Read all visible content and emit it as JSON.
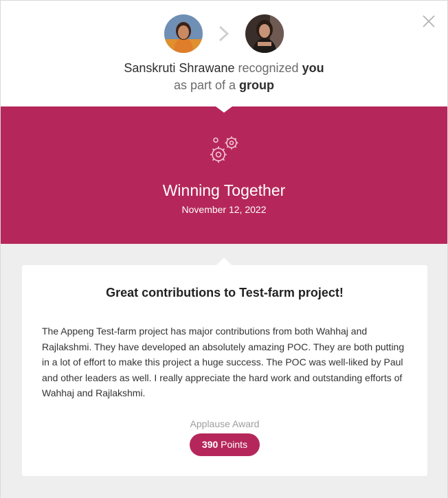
{
  "header": {
    "sender_name": "Sanskruti Shrawane",
    "verb": "recognized",
    "recipient": "you",
    "line2_prefix": "as part of a",
    "line2_group": "group"
  },
  "award": {
    "title": "Winning Together",
    "date": "November 12, 2022",
    "icon": "gears-icon"
  },
  "message": {
    "title": "Great contributions to Test-farm project!",
    "body": "The Appeng Test-farm project has major contributions from both Wahhaj and Rajlakshmi. They have developed an absolutely amazing POC. They are both putting in a lot of effort to make this project a huge success. The POC was well-liked by Paul and other leaders as well. I really appreciate the hard work and outstanding efforts of Wahhaj and Rajlakshmi."
  },
  "footer": {
    "award_type": "Applause Award",
    "points_value": "390",
    "points_label": "Points"
  },
  "colors": {
    "brand": "#b5275a",
    "background_lower": "#eeeeee"
  }
}
